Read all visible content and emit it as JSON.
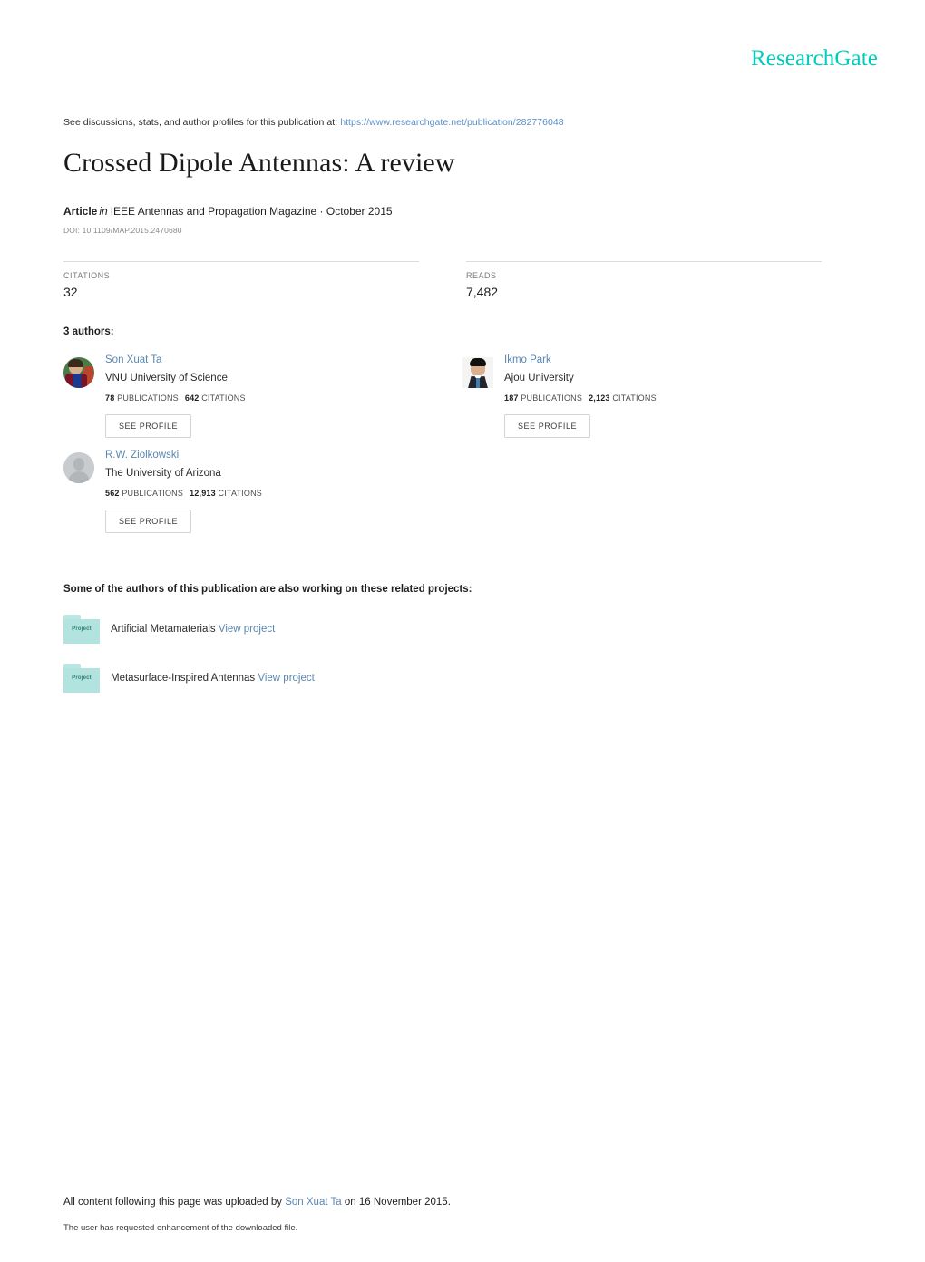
{
  "brand": {
    "name": "ResearchGate",
    "color": "#00ccbb"
  },
  "header": {
    "see_prefix": "See discussions, stats, and author profiles for this publication at:",
    "url": "https://www.researchgate.net/publication/282776048"
  },
  "publication": {
    "title": "Crossed Dipole Antennas: A review",
    "type_label": "Article",
    "in_word": "in",
    "venue": "IEEE Antennas and Propagation Magazine · October 2015",
    "doi": "DOI: 10.1109/MAP.2015.2470680"
  },
  "stats": [
    {
      "caption": "CITATIONS",
      "value": "32"
    },
    {
      "caption": "READS",
      "value": "7,482"
    }
  ],
  "authors_heading": "3 authors:",
  "authors": [
    {
      "name": "Son Xuat Ta",
      "affiliation": "VNU University of Science",
      "publications": "78",
      "publications_label": "PUBLICATIONS",
      "citations": "642",
      "citations_label": "CITATIONS",
      "button": "SEE PROFILE",
      "avatar": "photo-avatar-son-xuat-ta"
    },
    {
      "name": "Ikmo Park",
      "affiliation": "Ajou University",
      "publications": "187",
      "publications_label": "PUBLICATIONS",
      "citations": "2,123",
      "citations_label": "CITATIONS",
      "button": "SEE PROFILE",
      "avatar": "photo-avatar-ikmo-park"
    },
    {
      "name": "R.W. Ziolkowski",
      "affiliation": "The University of Arizona",
      "publications": "562",
      "publications_label": "PUBLICATIONS",
      "citations": "12,913",
      "citations_label": "CITATIONS",
      "button": "SEE PROFILE",
      "avatar": "default-person-avatar"
    }
  ],
  "projects_heading": "Some of the authors of this publication are also working on these related projects:",
  "projects": [
    {
      "icon_label": "Project",
      "title": "Artificial Metamaterials",
      "link": "View project"
    },
    {
      "icon_label": "Project",
      "title": "Metasurface-Inspired Antennas",
      "link": "View project"
    }
  ],
  "footer": {
    "upload_prefix": "All content following this page was uploaded by",
    "uploader": "Son Xuat Ta",
    "upload_suffix": "on 16 November 2015.",
    "enhancement": "The user has requested enhancement of the downloaded file."
  }
}
